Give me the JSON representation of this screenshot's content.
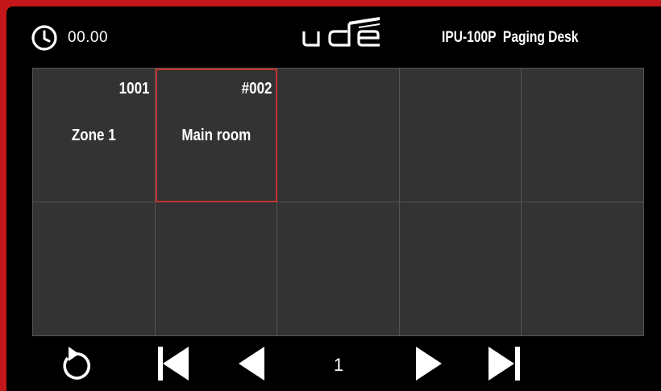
{
  "header": {
    "time": "00.00",
    "logo_text": "ude",
    "device_title": "IPU-100P  Paging Desk"
  },
  "zones": [
    {
      "number": "1001",
      "name": "Zone 1",
      "selected": false
    },
    {
      "number": "#002",
      "name": "Main room",
      "selected": true
    },
    {
      "number": "",
      "name": "",
      "selected": false
    },
    {
      "number": "",
      "name": "",
      "selected": false
    },
    {
      "number": "",
      "name": "",
      "selected": false
    },
    {
      "number": "",
      "name": "",
      "selected": false
    },
    {
      "number": "",
      "name": "",
      "selected": false
    },
    {
      "number": "",
      "name": "",
      "selected": false
    },
    {
      "number": "",
      "name": "",
      "selected": false
    },
    {
      "number": "",
      "name": "",
      "selected": false
    }
  ],
  "footer": {
    "page": "1",
    "icons": [
      "reset-icon",
      "first-page-icon",
      "previous-page-icon",
      "next-page-icon",
      "last-page-icon"
    ]
  },
  "colors": {
    "background": "#000000",
    "tile": "#333333",
    "tile_border": "#555555",
    "selected_border": "#c23331",
    "frame": "#c2161b",
    "text": "#ffffff"
  }
}
